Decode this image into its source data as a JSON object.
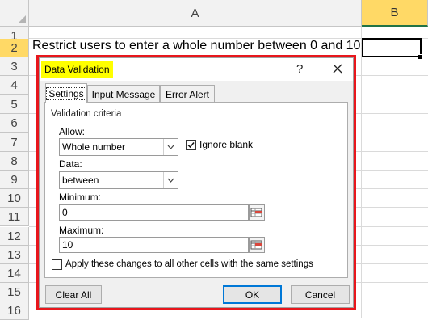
{
  "sheet": {
    "columns": [
      "A",
      "B"
    ],
    "rows": [
      "1",
      "2",
      "3",
      "4",
      "5",
      "6",
      "7",
      "8",
      "9",
      "10",
      "11",
      "12",
      "13",
      "14",
      "15",
      "16"
    ],
    "cell_a2": "Restrict users to enter a whole number between 0 and 10:",
    "cell_b2": ""
  },
  "dialog": {
    "title": "Data Validation",
    "help": "?",
    "tabs": [
      "Settings",
      "Input Message",
      "Error Alert"
    ],
    "group_label": "Validation criteria",
    "allow_label": "Allow:",
    "allow_value": "Whole number",
    "ignore_blank_label": "Ignore blank",
    "ignore_blank_checked": true,
    "data_label": "Data:",
    "data_value": "between",
    "minimum_label": "Minimum:",
    "minimum_value": "0",
    "maximum_label": "Maximum:",
    "maximum_value": "10",
    "apply_all_label": "Apply these changes to all other cells with the same settings",
    "apply_all_checked": false,
    "clear_all_label": "Clear All",
    "ok_label": "OK",
    "cancel_label": "Cancel"
  },
  "colors": {
    "highlight_yellow": "#ffff00",
    "outline_red": "#e8161c",
    "selected_header": "#ffd966"
  }
}
